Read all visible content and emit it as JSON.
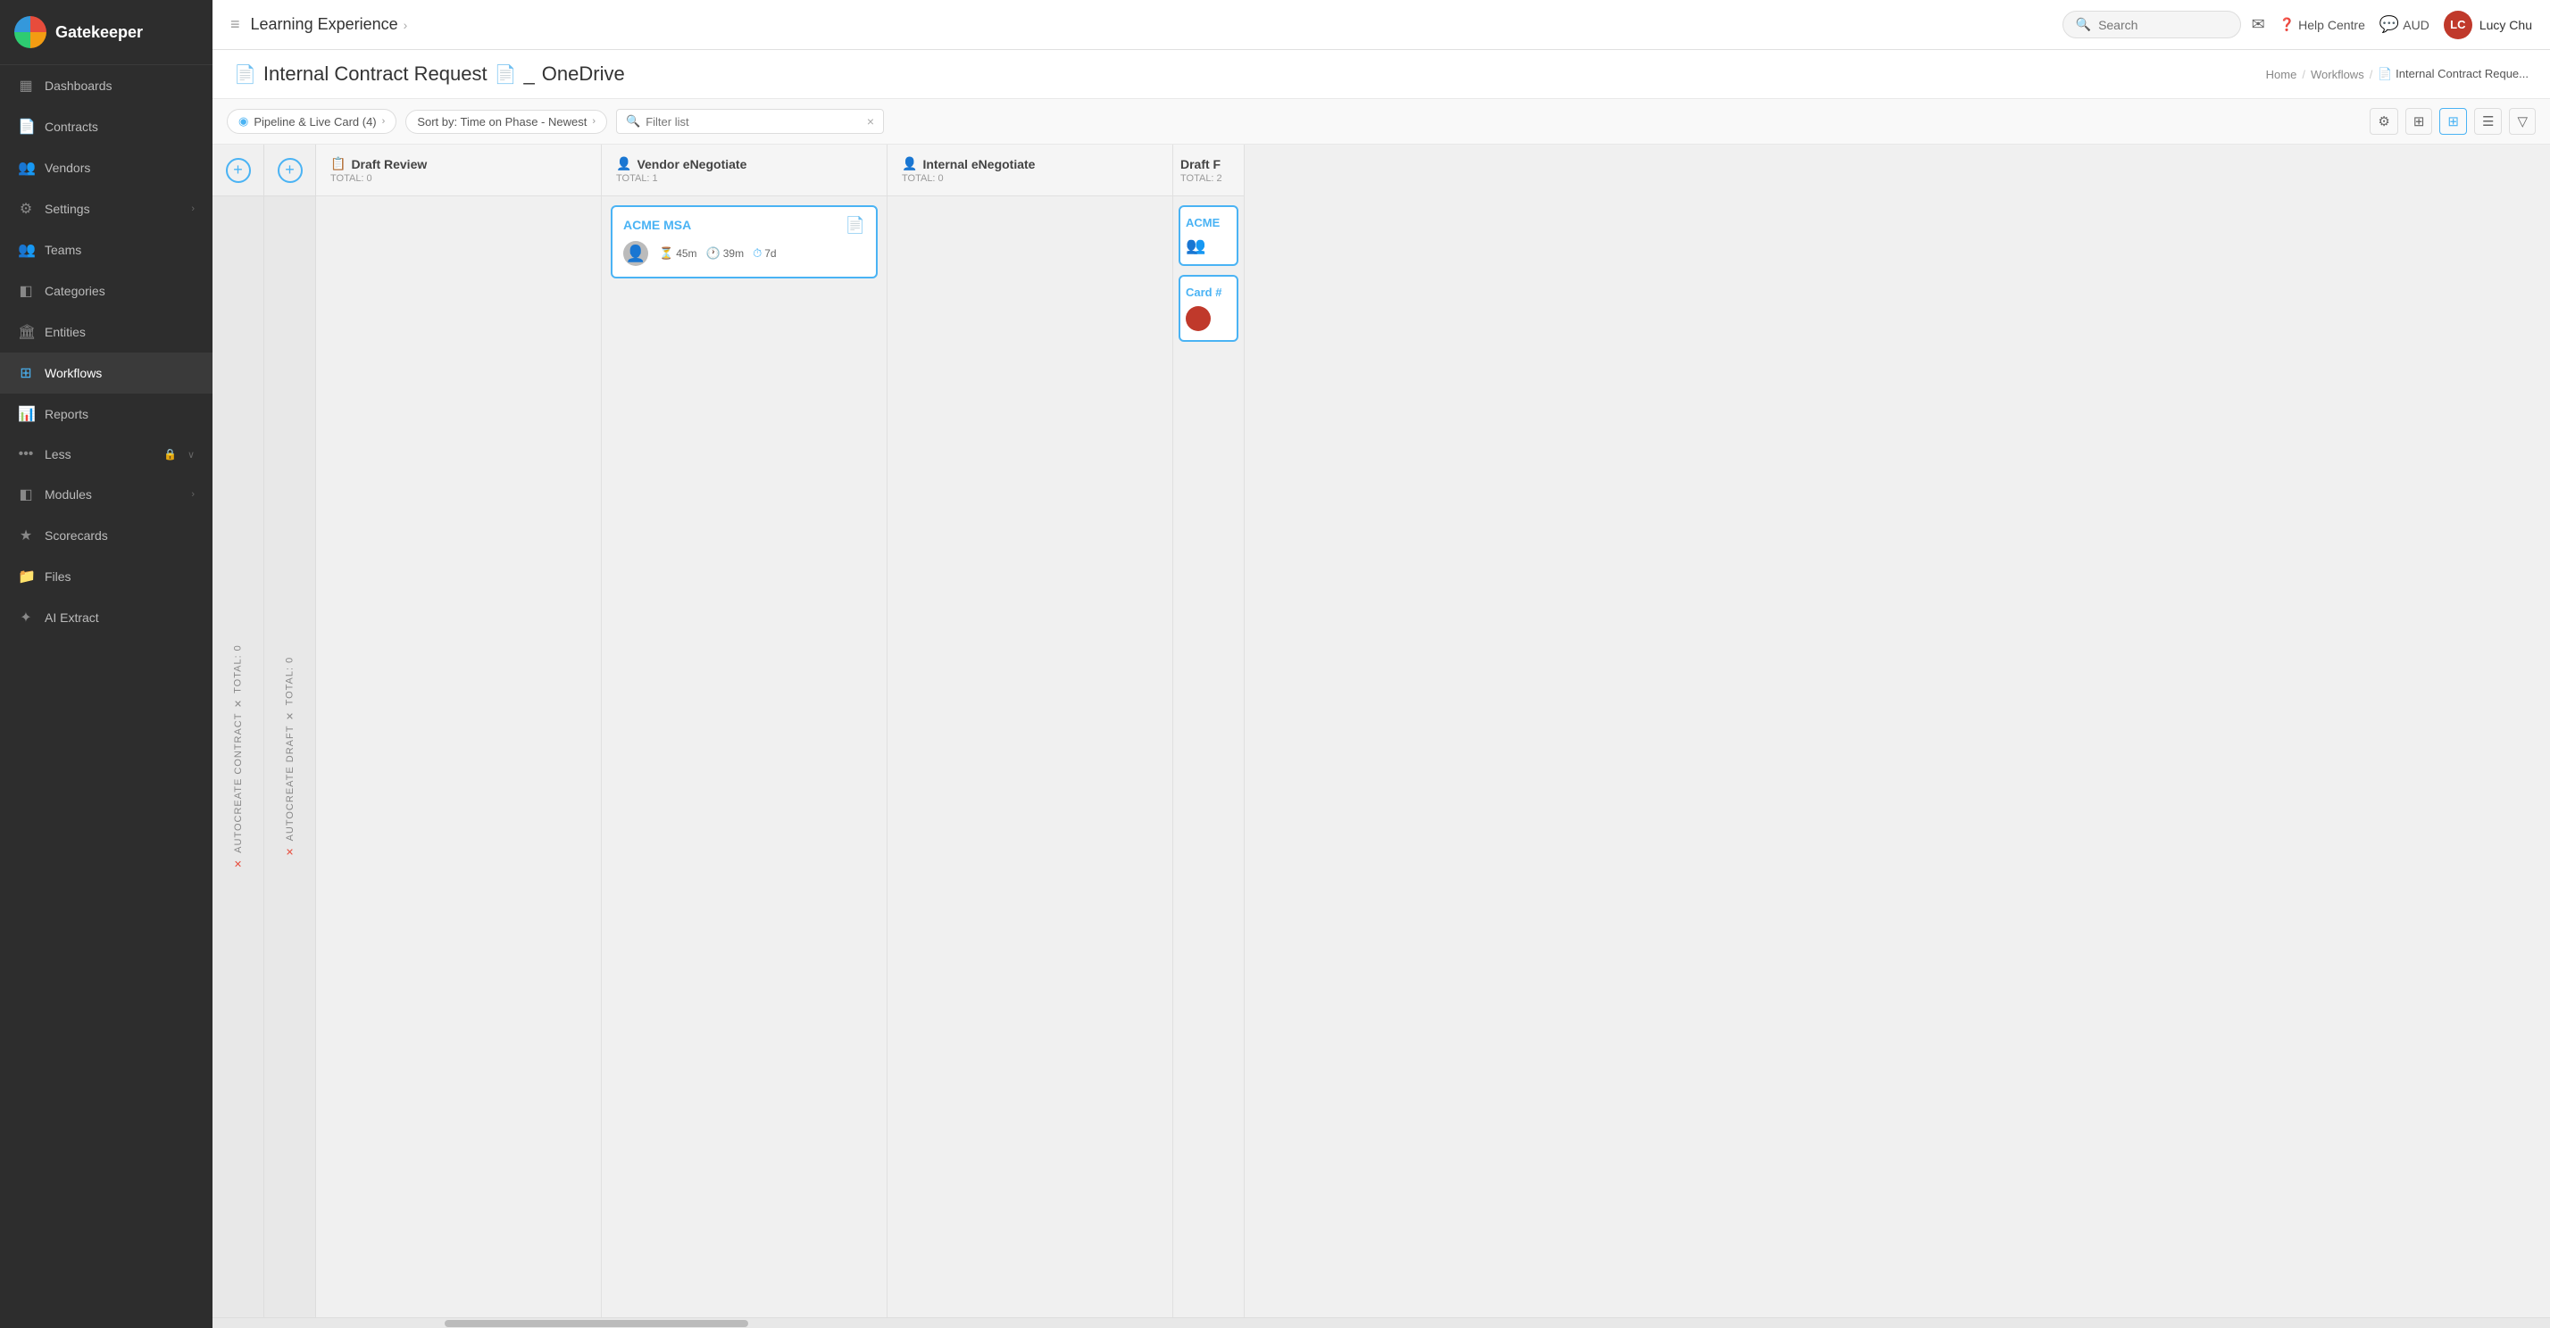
{
  "app": {
    "name": "Gatekeeper"
  },
  "topbar": {
    "menu_icon": "☰",
    "title": "Learning Experience",
    "title_chevron": "›",
    "search_placeholder": "Search",
    "help_label": "Help Centre",
    "currency": "AUD",
    "username": "Lucy Chu"
  },
  "page": {
    "title_icon": "📄",
    "title": "Internal Contract Request",
    "title_icon2": "📄",
    "title_separator": "_",
    "title_suffix": "OneDrive",
    "breadcrumb": {
      "home": "Home",
      "sep1": "/",
      "workflows": "Workflows",
      "sep2": "/",
      "current": "Internal Contract Reque..."
    }
  },
  "filter_bar": {
    "pipeline_label": "Pipeline & Live Card (4)",
    "sort_label": "Sort by: Time on Phase - Newest",
    "filter_placeholder": "Filter list",
    "clear_btn": "×"
  },
  "view_controls": {
    "settings_icon": "⚙",
    "columns_icon": "⊞",
    "grid_icon": "⊞",
    "list_icon": "☰",
    "filter_icon": "▼"
  },
  "kanban": {
    "lane1": {
      "label": "AUTOCREATE CONTRACT ✕",
      "total_label": "TOTAL: 0"
    },
    "lane2": {
      "label": "AUTOCREATE DRAFT ✕",
      "total_label": "TOTAL: 0"
    },
    "columns": [
      {
        "id": "draft-review",
        "title": "Draft Review",
        "icon": "📋",
        "total": "TOTAL: 0",
        "cards": []
      },
      {
        "id": "vendor-enegotiate",
        "title": "Vendor eNegotiate",
        "icon": "👤",
        "total": "TOTAL: 1",
        "cards": [
          {
            "id": "acme-msa",
            "title": "ACME MSA",
            "doc_icon": "📄",
            "avatar_type": "user",
            "meta": [
              {
                "icon": "⏳",
                "value": "45m"
              },
              {
                "icon": "🕐",
                "value": "39m"
              },
              {
                "icon": "⏱",
                "value": "7d"
              }
            ],
            "highlighted": true
          }
        ]
      },
      {
        "id": "internal-enegotiate",
        "title": "Internal eNegotiate",
        "icon": "👤",
        "total": "TOTAL: 0",
        "cards": []
      }
    ],
    "partial_columns": [
      {
        "id": "draft-final",
        "title": "Draft F",
        "total": "TOTAL: 2",
        "cards": [
          {
            "id": "acme-partial",
            "title": "ACME",
            "has_teams_icon": true,
            "highlighted": true
          },
          {
            "id": "card-partial",
            "title": "Card #",
            "has_avatar": true,
            "highlighted": true
          }
        ]
      }
    ]
  },
  "sidebar": {
    "items": [
      {
        "id": "dashboards",
        "label": "Dashboards",
        "icon": "▦"
      },
      {
        "id": "contracts",
        "label": "Contracts",
        "icon": "📄"
      },
      {
        "id": "vendors",
        "label": "Vendors",
        "icon": "👥"
      },
      {
        "id": "settings",
        "label": "Settings",
        "icon": "⚙",
        "has_arrow": true
      },
      {
        "id": "teams",
        "label": "Teams",
        "icon": "👥"
      },
      {
        "id": "categories",
        "label": "Categories",
        "icon": "◧"
      },
      {
        "id": "entities",
        "label": "Entities",
        "icon": "🏛"
      },
      {
        "id": "workflows",
        "label": "Workflows",
        "icon": "⊞",
        "active": true
      },
      {
        "id": "reports",
        "label": "Reports",
        "icon": "📊"
      },
      {
        "id": "less",
        "label": "Less",
        "icon": "•••",
        "has_lock": true,
        "has_arrow": true
      },
      {
        "id": "modules",
        "label": "Modules",
        "icon": "◧",
        "has_arrow": true
      },
      {
        "id": "scorecards",
        "label": "Scorecards",
        "icon": "★"
      },
      {
        "id": "files",
        "label": "Files",
        "icon": "📁"
      },
      {
        "id": "ai-extract",
        "label": "AI Extract",
        "icon": "✦"
      }
    ]
  }
}
